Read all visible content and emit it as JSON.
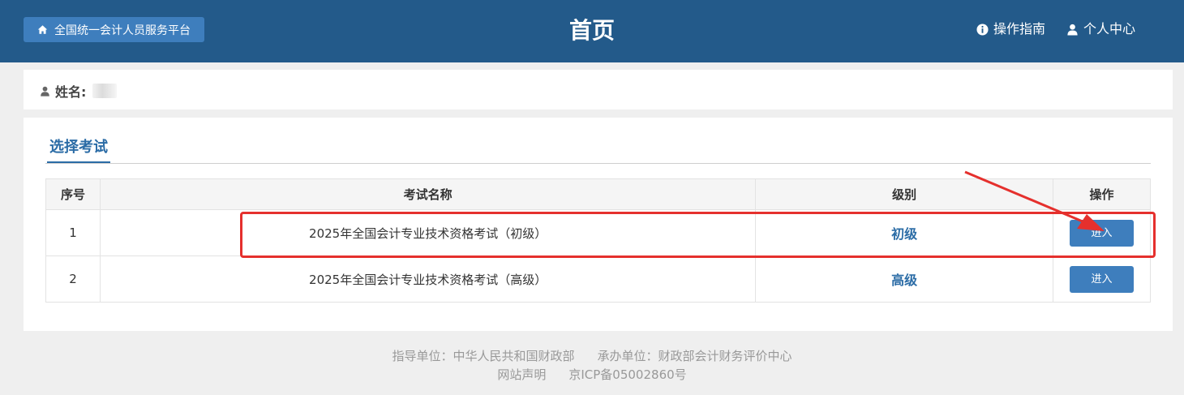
{
  "header": {
    "home_label": "全国统一会计人员服务平台",
    "title": "首页",
    "guide_label": "操作指南",
    "user_center_label": "个人中心"
  },
  "profile": {
    "name_label": "姓名:"
  },
  "exam_section": {
    "tab_title": "选择考试",
    "columns": [
      "序号",
      "考试名称",
      "级别",
      "操作"
    ],
    "rows": [
      {
        "index": "1",
        "name": "2025年全国会计专业技术资格考试（初级）",
        "level": "初级",
        "action": "进入"
      },
      {
        "index": "2",
        "name": "2025年全国会计专业技术资格考试（高级）",
        "level": "高级",
        "action": "进入"
      }
    ]
  },
  "footer": {
    "guide_unit": "指导单位：中华人民共和国财政部",
    "host_unit": "承办单位：财政部会计财务评价中心",
    "statement": "网站声明",
    "icp": "京ICP备05002860号"
  },
  "colors": {
    "header_bg": "#235a8a",
    "button_bg": "#3e7ebd",
    "accent": "#2b6ca6",
    "annotation_red": "#e5302d"
  }
}
